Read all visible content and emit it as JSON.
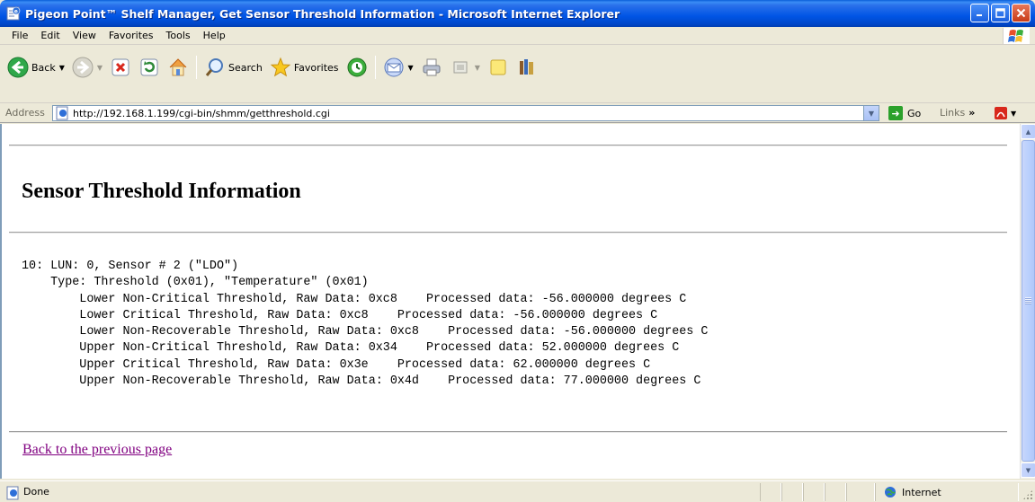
{
  "window": {
    "title": "Pigeon Point™ Shelf Manager, Get Sensor Threshold Information - Microsoft Internet Explorer"
  },
  "menu": {
    "items": [
      "File",
      "Edit",
      "View",
      "Favorites",
      "Tools",
      "Help"
    ]
  },
  "toolbar": {
    "back_label": "Back",
    "search_label": "Search",
    "favorites_label": "Favorites"
  },
  "address": {
    "label": "Address",
    "url": "http://192.168.1.199/cgi-bin/shmm/getthreshold.cgi",
    "go_label": "Go",
    "links_label": "Links"
  },
  "page": {
    "heading": "Sensor Threshold Information",
    "sensor_header": "10: LUN: 0, Sensor # 2 (\"LDO\")",
    "sensor_type": "    Type: Threshold (0x01), \"Temperature\" (0x01)",
    "thresholds": [
      "        Lower Non-Critical Threshold, Raw Data: 0xc8    Processed data: -56.000000 degrees C",
      "        Lower Critical Threshold, Raw Data: 0xc8    Processed data: -56.000000 degrees C",
      "        Lower Non-Recoverable Threshold, Raw Data: 0xc8    Processed data: -56.000000 degrees C",
      "        Upper Non-Critical Threshold, Raw Data: 0x34    Processed data: 52.000000 degrees C",
      "        Upper Critical Threshold, Raw Data: 0x3e    Processed data: 62.000000 degrees C",
      "        Upper Non-Recoverable Threshold, Raw Data: 0x4d    Processed data: 77.000000 degrees C"
    ],
    "back_link": "Back to the previous page"
  },
  "status": {
    "text": "Done",
    "zone": "Internet"
  }
}
